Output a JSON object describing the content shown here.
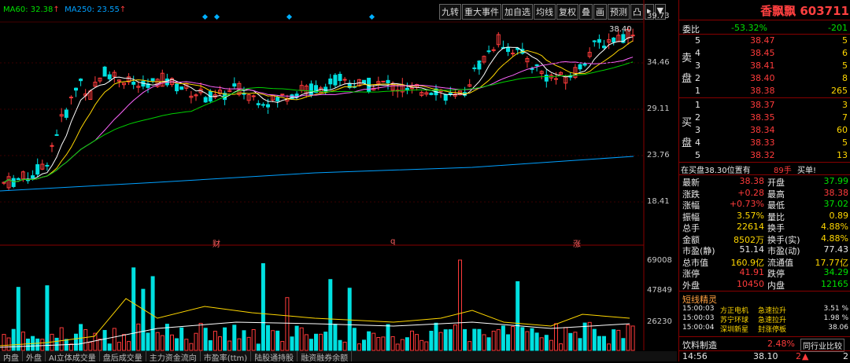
{
  "ma_legend": {
    "ma60": "MA60: 32.38",
    "ma60_arrow": "↑",
    "ma250": "MA250: 23.55",
    "ma250_arrow": "↑"
  },
  "toolbar": [
    "九转",
    "重大事件",
    "加自选",
    "均线",
    "复权",
    "叠",
    "画",
    "预测",
    "凸",
    "▸",
    "▼"
  ],
  "price_axis": [
    "39.73",
    "34.46",
    "29.11",
    "23.76",
    "18.41"
  ],
  "max_price_label": "38.40",
  "event_markers": [
    "财",
    "q",
    "涨"
  ],
  "volume_axis": [
    "69008",
    "47849",
    "26230"
  ],
  "bottom_tabs": [
    "内盘",
    "外盘",
    "AI立体成交量",
    "盘后成交量",
    "主力资金流向",
    "市盈率(ttm)",
    "陆股通持股",
    "融资融券余额"
  ],
  "quote": {
    "name": "香飘飘 603711",
    "webi_label": "委比",
    "webi_value": "-53.32%",
    "webi_diff": "-201",
    "sell_label": "卖\n盘",
    "sell": [
      {
        "lvl": "5",
        "price": "38.47",
        "vol": "5"
      },
      {
        "lvl": "4",
        "price": "38.45",
        "vol": "6"
      },
      {
        "lvl": "3",
        "price": "38.41",
        "vol": "5"
      },
      {
        "lvl": "2",
        "price": "38.40",
        "vol": "8"
      },
      {
        "lvl": "1",
        "price": "38.38",
        "vol": "265"
      }
    ],
    "buy": [
      {
        "lvl": "1",
        "price": "38.37",
        "vol": "3"
      },
      {
        "lvl": "2",
        "price": "38.35",
        "vol": "7"
      },
      {
        "lvl": "3",
        "price": "38.34",
        "vol": "60"
      },
      {
        "lvl": "4",
        "price": "38.33",
        "vol": "5"
      },
      {
        "lvl": "5",
        "price": "38.32",
        "vol": "13"
      }
    ],
    "buy_label_1": "买",
    "buy_label_2": "盘",
    "sell_label_1": "卖",
    "sell_label_2": "盘",
    "notice": "在买盘38.30位置有",
    "notice_vol": "89手",
    "notice_tail": "买单!",
    "stats": [
      {
        "l1": "最新",
        "v1": "38.38",
        "c1": "red",
        "l2": "开盘",
        "v2": "37.99",
        "c2": "green"
      },
      {
        "l1": "涨跌",
        "v1": "+0.28",
        "c1": "red",
        "l2": "最高",
        "v2": "38.38",
        "c2": "red"
      },
      {
        "l1": "涨幅",
        "v1": "+0.73%",
        "c1": "red",
        "l2": "最低",
        "v2": "37.02",
        "c2": "green"
      },
      {
        "l1": "振幅",
        "v1": "3.57%",
        "c1": "yellow",
        "l2": "量比",
        "v2": "0.89",
        "c2": "yellow"
      },
      {
        "l1": "总手",
        "v1": "22614",
        "c1": "yellow",
        "l2": "换手",
        "v2": "4.88%",
        "c2": "yellow"
      },
      {
        "l1": "金额",
        "v1": "8502万",
        "c1": "yellow",
        "l2": "换手(实)",
        "v2": "4.88%",
        "c2": "yellow"
      },
      {
        "l1": "市盈(静)",
        "v1": "51.14",
        "c1": "white",
        "l2": "市盈(动)",
        "v2": "77.43",
        "c2": "white"
      },
      {
        "l1": "总市值",
        "v1": "160.9亿",
        "c1": "yellow",
        "l2": "流通值",
        "v2": "17.77亿",
        "c2": "yellow"
      },
      {
        "l1": "涨停",
        "v1": "41.91",
        "c1": "red",
        "l2": "跌停",
        "v2": "34.29",
        "c2": "green"
      },
      {
        "l1": "外盘",
        "v1": "10450",
        "c1": "red",
        "l2": "内盘",
        "v2": "12165",
        "c2": "green"
      }
    ],
    "elves_title": "短线精灵",
    "elves": [
      {
        "time": "15:00:03",
        "name": "方正电机",
        "event": "急速拉升",
        "value": "3.51 %"
      },
      {
        "time": "15:00:03",
        "name": "苏宁环球",
        "event": "急速拉升",
        "value": "1.98 %"
      },
      {
        "time": "15:00:04",
        "name": "深圳新星",
        "event": "封涨停板",
        "value": "38.06"
      }
    ],
    "industry_name": "饮料制造",
    "industry_pct": "2.48%",
    "industry_btn": "同行业比较",
    "footer_time": "14:56",
    "footer_price": "38.10",
    "footer_num1": "2",
    "footer_num2": "2"
  },
  "colors": {
    "up": "#ff3b3b",
    "down": "#00e0e0",
    "ma5": "#ffffff",
    "ma10": "#ffd700",
    "ma20": "#ff66ff",
    "ma60": "#00d000",
    "ma250": "#00a0ff"
  }
}
